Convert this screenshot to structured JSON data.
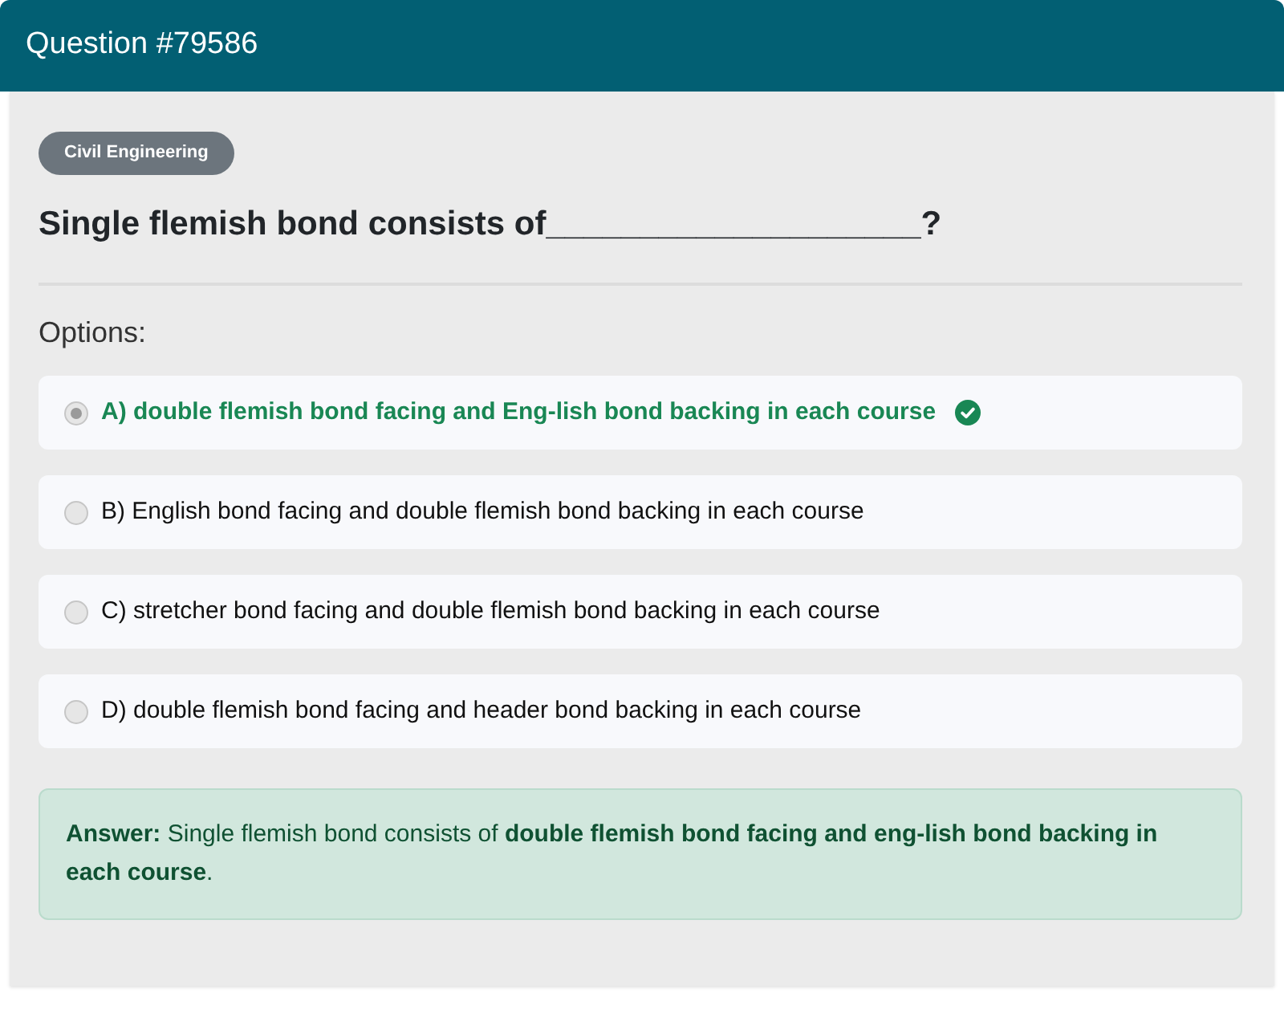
{
  "header": {
    "title": "Question #79586"
  },
  "question": {
    "category": "Civil Engineering",
    "text": "Single flemish bond consists of____________________?"
  },
  "options_label": "Options:",
  "options": [
    {
      "text": "A) double flemish bond facing and Eng-lish bond backing in each course",
      "selected": true,
      "correct": true
    },
    {
      "text": "B) English bond facing and double flemish bond backing in each course",
      "selected": false,
      "correct": false
    },
    {
      "text": "C) stretcher bond facing and double flemish bond backing in each course",
      "selected": false,
      "correct": false
    },
    {
      "text": "D) double flemish bond facing and header bond backing in each course",
      "selected": false,
      "correct": false
    }
  ],
  "answer": {
    "text": "**Answer:** Single flemish bond consists of **double flemish bond facing and eng-lish bond backing in each course**."
  }
}
